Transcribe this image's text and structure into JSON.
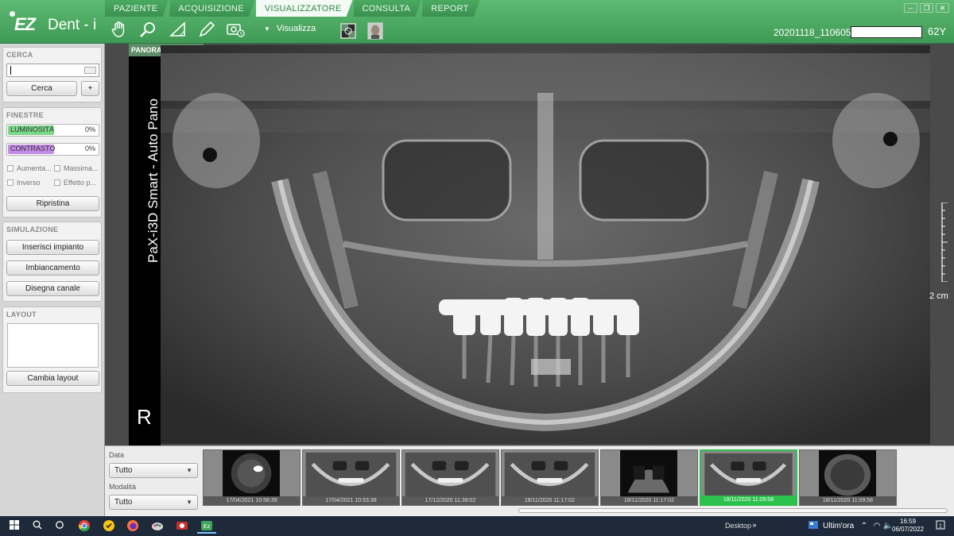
{
  "app": {
    "logo_main": "EZ",
    "logo_sub": "Dent - i"
  },
  "tabs": [
    {
      "label": "PAZIENTE"
    },
    {
      "label": "ACQUISIZIONE"
    },
    {
      "label": "VISUALIZZATORE",
      "active": true
    },
    {
      "label": "CONSULTA"
    },
    {
      "label": "REPORT"
    }
  ],
  "toolbar": {
    "tools": [
      "hand-icon",
      "zoom-icon",
      "ruler-triangle-icon",
      "pencil-icon",
      "camera-capture-icon"
    ],
    "view_label": "Visualizza",
    "patient_id": "20201118_110605",
    "patient_age": "62Y"
  },
  "left_panel": {
    "search": {
      "title": "CERCA",
      "value": "",
      "search_button": "Cerca",
      "add_button": "+"
    },
    "windows": {
      "title": "FINESTRE",
      "brightness_label": "LUMINOSITÀ",
      "brightness_value": "0%",
      "contrast_label": "CONTRASTO",
      "contrast_value": "0%",
      "check_1": "Aumenta...",
      "check_2": "Massima...",
      "check_3": "Inverso",
      "check_4": "Effetto p...",
      "reset_button": "Ripristina"
    },
    "simulation": {
      "title": "SIMULAZIONE",
      "implant_button": "Inserisci impianto",
      "whitening_button": "Imbiancamento",
      "canal_button": "Disegna canale"
    },
    "layout": {
      "title": "LAYOUT",
      "change_button": "Cambia layout"
    }
  },
  "viewer": {
    "label": "PANORAMICA",
    "device": "PaX-i3D Smart - Auto Pano",
    "side": "R",
    "scale": "2 cm"
  },
  "filters": {
    "date_label": "Data",
    "date_value": "Tutto",
    "modality_label": "Modalità",
    "modality_value": "Tutto"
  },
  "thumbnails": [
    {
      "date": "17/04/2021 10:58:39",
      "kind": "ct-axial"
    },
    {
      "date": "17/04/2021 10:53:38",
      "kind": "pano"
    },
    {
      "date": "17/12/2020 11:39:02",
      "kind": "pano"
    },
    {
      "date": "18/11/2020 11:17:02",
      "kind": "pano"
    },
    {
      "date": "18/11/2020 11:17:02",
      "kind": "ct-coronal"
    },
    {
      "date": "18/11/2020 11:09:58",
      "kind": "pano",
      "selected": true
    },
    {
      "date": "18/11/2020 11:09:58",
      "kind": "ct-skull"
    }
  ],
  "taskbar": {
    "desktop_label": "Desktop",
    "news_label": "Ultim'ora",
    "time": "16:59",
    "date": "06/07/2022"
  }
}
